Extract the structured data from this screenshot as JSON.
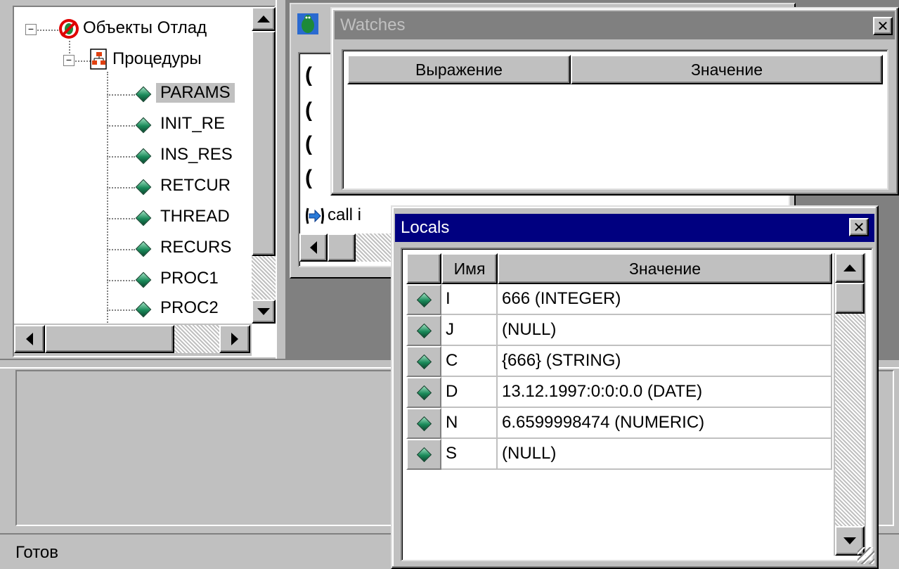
{
  "tree": {
    "root_label": "Объекты Отлад",
    "procedures_label": "Процедуры",
    "items": [
      {
        "label": "PARAMS"
      },
      {
        "label": "INIT_RE"
      },
      {
        "label": "INS_RES"
      },
      {
        "label": "RETCUR"
      },
      {
        "label": "THREAD"
      },
      {
        "label": "RECURS"
      },
      {
        "label": "PROC1"
      },
      {
        "label": "PROC2"
      }
    ]
  },
  "code": {
    "visible_line": "call i"
  },
  "watches": {
    "title": "Watches",
    "columns": [
      "Выражение",
      "Значение"
    ]
  },
  "locals": {
    "title": "Locals",
    "columns": [
      "Имя",
      "Значение"
    ],
    "rows": [
      {
        "name": "I",
        "value": "666 (INTEGER)"
      },
      {
        "name": "J",
        "value": "(NULL)"
      },
      {
        "name": "C",
        "value": "{666} (STRING)"
      },
      {
        "name": "D",
        "value": "13.12.1997:0:0:0.0 (DATE)"
      },
      {
        "name": "N",
        "value": "6.6599998474 (NUMERIC)"
      },
      {
        "name": "S",
        "value": "(NULL)"
      }
    ]
  },
  "status": {
    "text": "Готов"
  },
  "colors": {
    "face": "#c0c0c0",
    "active_title": "#000080",
    "inactive_title": "#808080"
  }
}
